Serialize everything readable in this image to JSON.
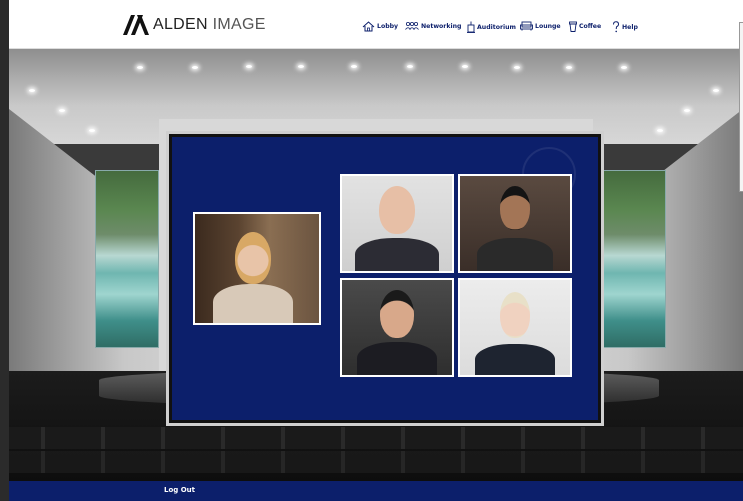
{
  "brand": {
    "name_strong": "ALDEN",
    "name_light": " IMAGE"
  },
  "nav": [
    {
      "label": "Lobby",
      "icon": "home-icon"
    },
    {
      "label": "Networking",
      "icon": "people-icon"
    },
    {
      "label": "Auditorium",
      "icon": "podium-icon"
    },
    {
      "label": "Lounge",
      "icon": "sofa-icon"
    },
    {
      "label": "Coffee",
      "icon": "coffee-cup-icon"
    },
    {
      "label": "Help",
      "icon": "question-icon"
    }
  ],
  "colors": {
    "brand_navy": "#0c1f6b",
    "header_bg": "#ffffff"
  },
  "screen": {
    "presenters": [
      {
        "role": "main-speaker",
        "desc": "woman with blonde hair"
      },
      {
        "role": "panelist",
        "desc": "older bald man with glasses"
      },
      {
        "role": "panelist",
        "desc": "young man with glasses"
      },
      {
        "role": "panelist",
        "desc": "man with dark hair"
      },
      {
        "role": "panelist",
        "desc": "woman with blonde hair"
      }
    ]
  },
  "footer": {
    "logout_label": "Log Out"
  }
}
